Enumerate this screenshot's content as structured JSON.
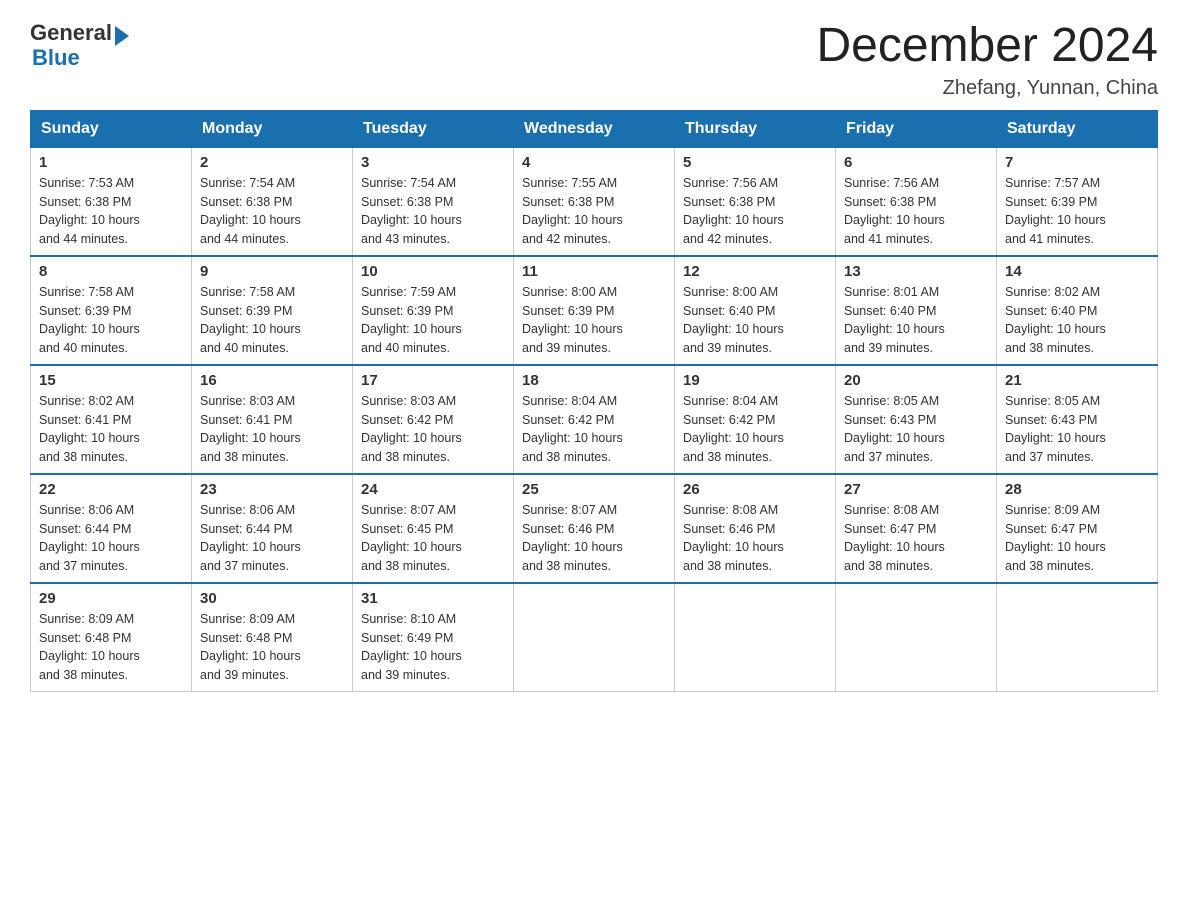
{
  "header": {
    "logo": {
      "general": "General",
      "blue": "Blue"
    },
    "title": "December 2024",
    "location": "Zhefang, Yunnan, China"
  },
  "weekdays": [
    "Sunday",
    "Monday",
    "Tuesday",
    "Wednesday",
    "Thursday",
    "Friday",
    "Saturday"
  ],
  "weeks": [
    [
      {
        "day": "1",
        "sunrise": "7:53 AM",
        "sunset": "6:38 PM",
        "daylight": "10 hours and 44 minutes."
      },
      {
        "day": "2",
        "sunrise": "7:54 AM",
        "sunset": "6:38 PM",
        "daylight": "10 hours and 44 minutes."
      },
      {
        "day": "3",
        "sunrise": "7:54 AM",
        "sunset": "6:38 PM",
        "daylight": "10 hours and 43 minutes."
      },
      {
        "day": "4",
        "sunrise": "7:55 AM",
        "sunset": "6:38 PM",
        "daylight": "10 hours and 42 minutes."
      },
      {
        "day": "5",
        "sunrise": "7:56 AM",
        "sunset": "6:38 PM",
        "daylight": "10 hours and 42 minutes."
      },
      {
        "day": "6",
        "sunrise": "7:56 AM",
        "sunset": "6:38 PM",
        "daylight": "10 hours and 41 minutes."
      },
      {
        "day": "7",
        "sunrise": "7:57 AM",
        "sunset": "6:39 PM",
        "daylight": "10 hours and 41 minutes."
      }
    ],
    [
      {
        "day": "8",
        "sunrise": "7:58 AM",
        "sunset": "6:39 PM",
        "daylight": "10 hours and 40 minutes."
      },
      {
        "day": "9",
        "sunrise": "7:58 AM",
        "sunset": "6:39 PM",
        "daylight": "10 hours and 40 minutes."
      },
      {
        "day": "10",
        "sunrise": "7:59 AM",
        "sunset": "6:39 PM",
        "daylight": "10 hours and 40 minutes."
      },
      {
        "day": "11",
        "sunrise": "8:00 AM",
        "sunset": "6:39 PM",
        "daylight": "10 hours and 39 minutes."
      },
      {
        "day": "12",
        "sunrise": "8:00 AM",
        "sunset": "6:40 PM",
        "daylight": "10 hours and 39 minutes."
      },
      {
        "day": "13",
        "sunrise": "8:01 AM",
        "sunset": "6:40 PM",
        "daylight": "10 hours and 39 minutes."
      },
      {
        "day": "14",
        "sunrise": "8:02 AM",
        "sunset": "6:40 PM",
        "daylight": "10 hours and 38 minutes."
      }
    ],
    [
      {
        "day": "15",
        "sunrise": "8:02 AM",
        "sunset": "6:41 PM",
        "daylight": "10 hours and 38 minutes."
      },
      {
        "day": "16",
        "sunrise": "8:03 AM",
        "sunset": "6:41 PM",
        "daylight": "10 hours and 38 minutes."
      },
      {
        "day": "17",
        "sunrise": "8:03 AM",
        "sunset": "6:42 PM",
        "daylight": "10 hours and 38 minutes."
      },
      {
        "day": "18",
        "sunrise": "8:04 AM",
        "sunset": "6:42 PM",
        "daylight": "10 hours and 38 minutes."
      },
      {
        "day": "19",
        "sunrise": "8:04 AM",
        "sunset": "6:42 PM",
        "daylight": "10 hours and 38 minutes."
      },
      {
        "day": "20",
        "sunrise": "8:05 AM",
        "sunset": "6:43 PM",
        "daylight": "10 hours and 37 minutes."
      },
      {
        "day": "21",
        "sunrise": "8:05 AM",
        "sunset": "6:43 PM",
        "daylight": "10 hours and 37 minutes."
      }
    ],
    [
      {
        "day": "22",
        "sunrise": "8:06 AM",
        "sunset": "6:44 PM",
        "daylight": "10 hours and 37 minutes."
      },
      {
        "day": "23",
        "sunrise": "8:06 AM",
        "sunset": "6:44 PM",
        "daylight": "10 hours and 37 minutes."
      },
      {
        "day": "24",
        "sunrise": "8:07 AM",
        "sunset": "6:45 PM",
        "daylight": "10 hours and 38 minutes."
      },
      {
        "day": "25",
        "sunrise": "8:07 AM",
        "sunset": "6:46 PM",
        "daylight": "10 hours and 38 minutes."
      },
      {
        "day": "26",
        "sunrise": "8:08 AM",
        "sunset": "6:46 PM",
        "daylight": "10 hours and 38 minutes."
      },
      {
        "day": "27",
        "sunrise": "8:08 AM",
        "sunset": "6:47 PM",
        "daylight": "10 hours and 38 minutes."
      },
      {
        "day": "28",
        "sunrise": "8:09 AM",
        "sunset": "6:47 PM",
        "daylight": "10 hours and 38 minutes."
      }
    ],
    [
      {
        "day": "29",
        "sunrise": "8:09 AM",
        "sunset": "6:48 PM",
        "daylight": "10 hours and 38 minutes."
      },
      {
        "day": "30",
        "sunrise": "8:09 AM",
        "sunset": "6:48 PM",
        "daylight": "10 hours and 39 minutes."
      },
      {
        "day": "31",
        "sunrise": "8:10 AM",
        "sunset": "6:49 PM",
        "daylight": "10 hours and 39 minutes."
      },
      null,
      null,
      null,
      null
    ]
  ],
  "labels": {
    "sunrise": "Sunrise:",
    "sunset": "Sunset:",
    "daylight": "Daylight:"
  }
}
